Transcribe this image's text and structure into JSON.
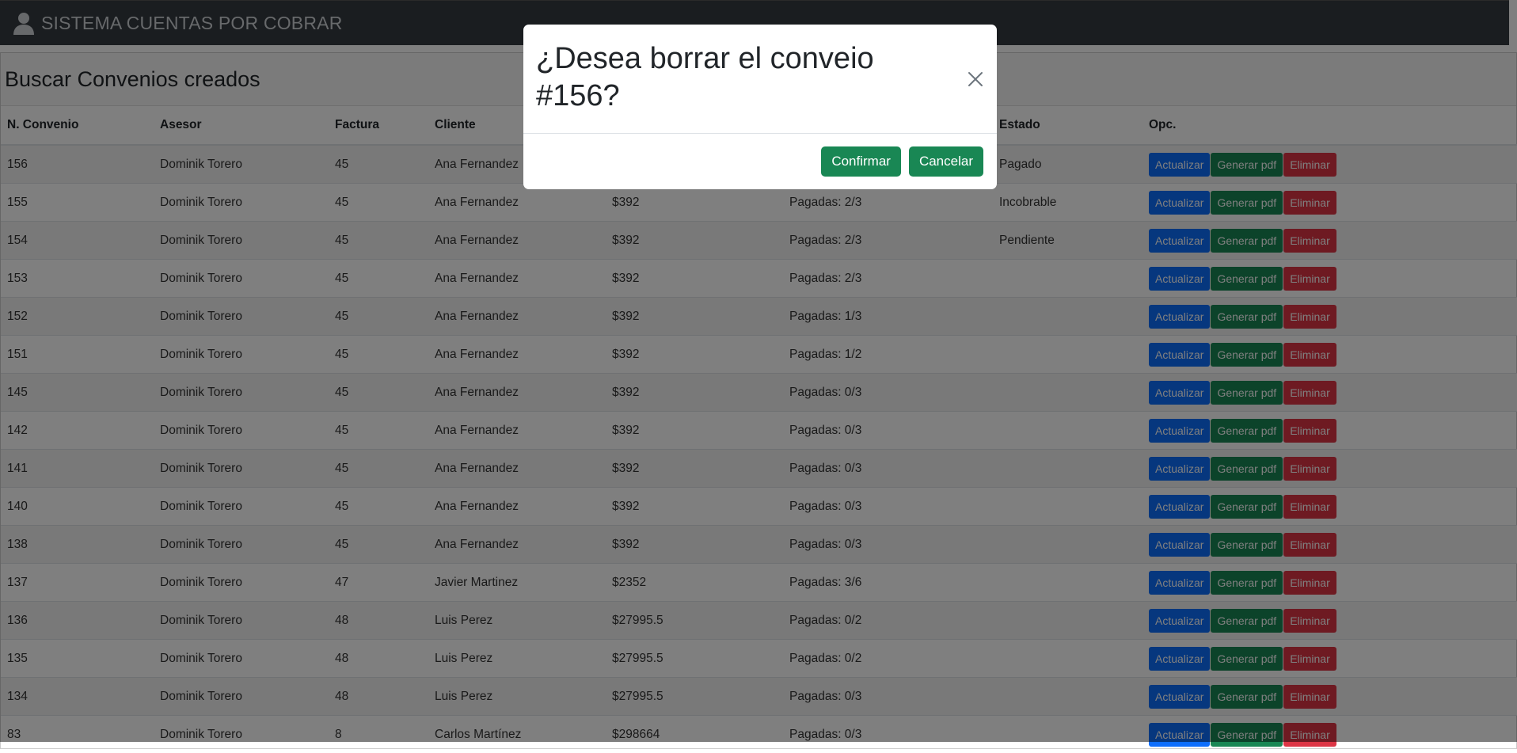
{
  "navbar": {
    "title": "SISTEMA CUENTAS POR COBRAR",
    "icon": "user-icon"
  },
  "card": {
    "title": "Buscar Convenios creados"
  },
  "table": {
    "headers": [
      "N. Convenio",
      "Asesor",
      "Factura",
      "Cliente",
      "",
      "",
      "Estado",
      "Opc."
    ],
    "buttons": {
      "update": "Actualizar",
      "pdf": "Generar pdf",
      "delete": "Eliminar"
    },
    "rows": [
      [
        "156",
        "Dominik Torero",
        "45",
        "Ana Fernandez",
        "",
        "",
        "Pagado"
      ],
      [
        "155",
        "Dominik Torero",
        "45",
        "Ana Fernandez",
        "$392",
        "Pagadas: 2/3",
        "Incobrable"
      ],
      [
        "154",
        "Dominik Torero",
        "45",
        "Ana Fernandez",
        "$392",
        "Pagadas: 2/3",
        "Pendiente"
      ],
      [
        "153",
        "Dominik Torero",
        "45",
        "Ana Fernandez",
        "$392",
        "Pagadas: 2/3",
        ""
      ],
      [
        "152",
        "Dominik Torero",
        "45",
        "Ana Fernandez",
        "$392",
        "Pagadas: 1/3",
        ""
      ],
      [
        "151",
        "Dominik Torero",
        "45",
        "Ana Fernandez",
        "$392",
        "Pagadas: 1/2",
        ""
      ],
      [
        "145",
        "Dominik Torero",
        "45",
        "Ana Fernandez",
        "$392",
        "Pagadas: 0/3",
        ""
      ],
      [
        "142",
        "Dominik Torero",
        "45",
        "Ana Fernandez",
        "$392",
        "Pagadas: 0/3",
        ""
      ],
      [
        "141",
        "Dominik Torero",
        "45",
        "Ana Fernandez",
        "$392",
        "Pagadas: 0/3",
        ""
      ],
      [
        "140",
        "Dominik Torero",
        "45",
        "Ana Fernandez",
        "$392",
        "Pagadas: 0/3",
        ""
      ],
      [
        "138",
        "Dominik Torero",
        "45",
        "Ana Fernandez",
        "$392",
        "Pagadas: 0/3",
        ""
      ],
      [
        "137",
        "Dominik Torero",
        "47",
        "Javier Martinez",
        "$2352",
        "Pagadas: 3/6",
        ""
      ],
      [
        "136",
        "Dominik Torero",
        "48",
        "Luis Perez",
        "$27995.5",
        "Pagadas: 0/2",
        ""
      ],
      [
        "135",
        "Dominik Torero",
        "48",
        "Luis Perez",
        "$27995.5",
        "Pagadas: 0/2",
        ""
      ],
      [
        "134",
        "Dominik Torero",
        "48",
        "Luis Perez",
        "$27995.5",
        "Pagadas: 0/3",
        ""
      ],
      [
        "83",
        "Dominik Torero",
        "8",
        "Carlos Martínez",
        "$298664",
        "Pagadas: 0/3",
        ""
      ]
    ]
  },
  "modal": {
    "title": "¿Desea borrar el conveio #156?",
    "confirm": "Confirmar",
    "cancel": "Cancelar",
    "close_icon": "close-icon"
  },
  "colors": {
    "primary": "#0d6efd",
    "success": "#198754",
    "danger": "#dc3545",
    "navbar": "#343a40"
  }
}
